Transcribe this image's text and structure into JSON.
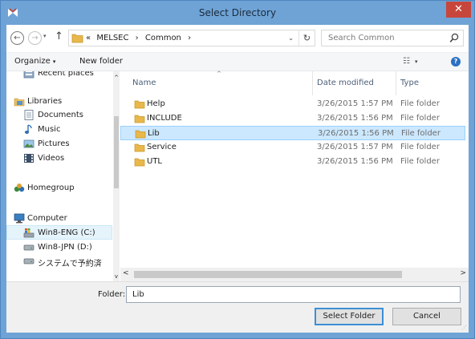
{
  "window": {
    "title": "Select Directory",
    "close_glyph": "✕",
    "app_icon": "mx-logo-icon"
  },
  "addressbar": {
    "back_glyph": "←",
    "forward_glyph": "→",
    "recent_glyph": "▾",
    "up_glyph": "↑",
    "path_prefix": "«",
    "path": [
      {
        "label": "MELSEC",
        "sep": "›"
      },
      {
        "label": "Common",
        "sep": "›"
      }
    ],
    "dropdown_glyph": "⌄",
    "refresh_glyph": "↻",
    "search_placeholder": "Search Common"
  },
  "commandbar": {
    "organize_label": "Organize",
    "organize_caret": "▾",
    "new_folder_label": "New folder",
    "view_glyph": "☷",
    "view_caret": "▾",
    "help_glyph": "?"
  },
  "navpane": {
    "items": [
      {
        "label": "Recent places",
        "icon": "recent-places-icon"
      },
      {
        "label": "Libraries",
        "icon": "libraries-icon"
      },
      {
        "label": "Documents",
        "icon": "documents-icon"
      },
      {
        "label": "Music",
        "icon": "music-icon"
      },
      {
        "label": "Pictures",
        "icon": "pictures-icon"
      },
      {
        "label": "Videos",
        "icon": "videos-icon"
      },
      {
        "label": "Homegroup",
        "icon": "homegroup-icon"
      },
      {
        "label": "Computer",
        "icon": "computer-icon"
      },
      {
        "label": "Win8-ENG (C:)",
        "icon": "system-drive-icon",
        "selected": true
      },
      {
        "label": "Win8-JPN (D:)",
        "icon": "drive-icon"
      },
      {
        "label": "システムで予約済",
        "icon": "drive-icon"
      }
    ],
    "scroll_up": "^",
    "scroll_down": "v"
  },
  "filelist": {
    "sort_indicator": "^",
    "columns": {
      "name": "Name",
      "date": "Date modified",
      "type": "Type"
    },
    "rows": [
      {
        "name": "Help",
        "date": "3/26/2015 1:57 PM",
        "type": "File folder"
      },
      {
        "name": "INCLUDE",
        "date": "3/26/2015 1:56 PM",
        "type": "File folder"
      },
      {
        "name": "Lib",
        "date": "3/26/2015 1:56 PM",
        "type": "File folder",
        "selected": true
      },
      {
        "name": "Service",
        "date": "3/26/2015 1:57 PM",
        "type": "File folder"
      },
      {
        "name": "UTL",
        "date": "3/26/2015 1:56 PM",
        "type": "File folder"
      }
    ],
    "hscroll_left": "<",
    "hscroll_right": ">"
  },
  "footer": {
    "folder_label": "Folder:",
    "folder_value": "Lib",
    "select_button": "Select Folder",
    "cancel_button": "Cancel",
    "grip_glyph": "⋰"
  },
  "colors": {
    "title_bar": "#6fa3d6",
    "close_button": "#c7463b",
    "selection": "#cce8ff",
    "folder": "#e8b84a"
  }
}
